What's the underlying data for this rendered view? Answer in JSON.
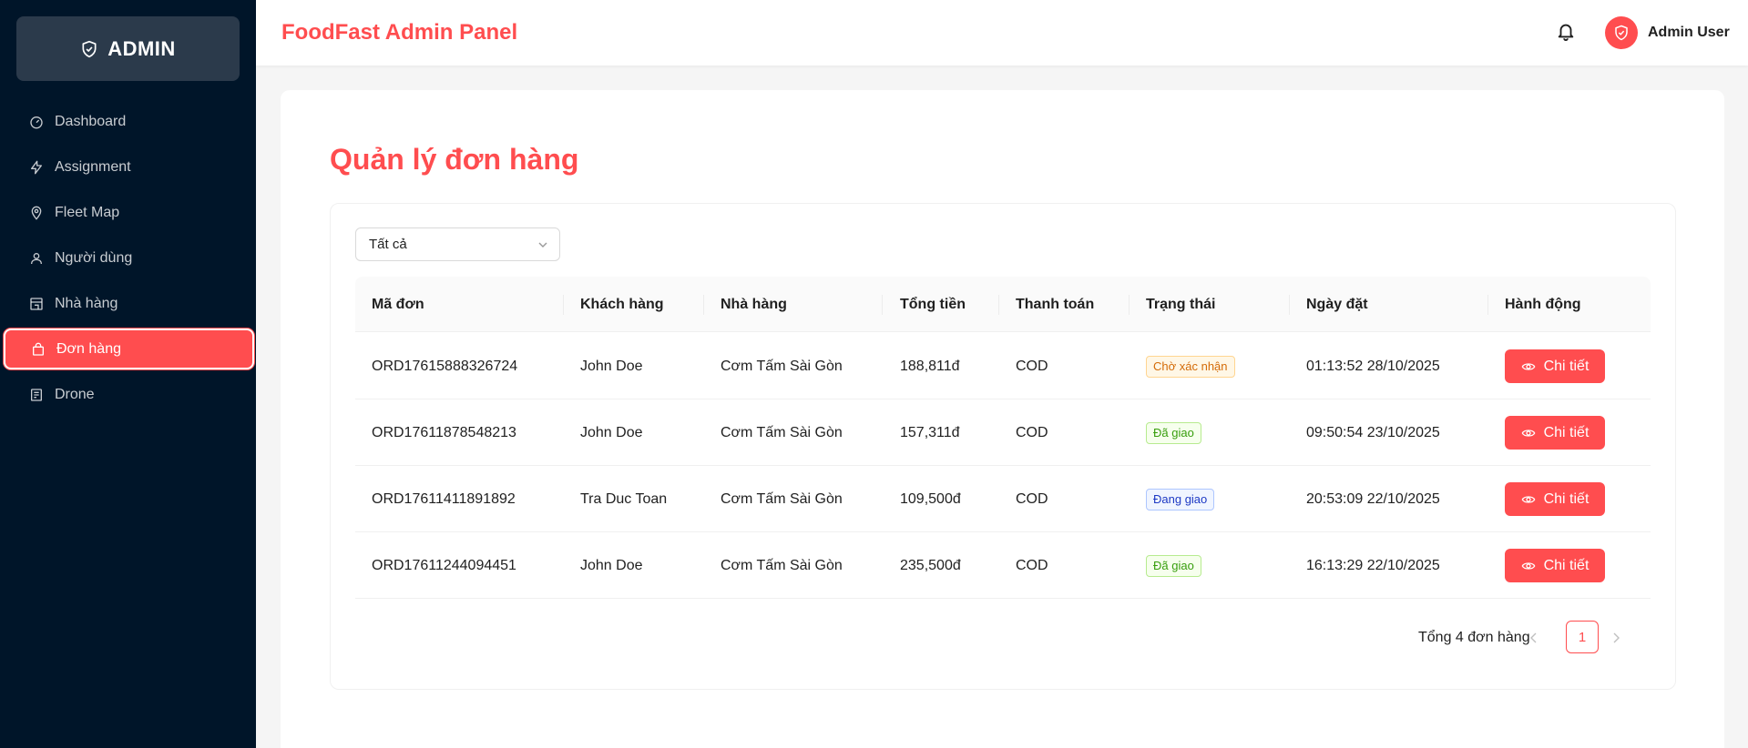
{
  "sidebar": {
    "brand": "ADMIN",
    "items": [
      {
        "label": "Dashboard",
        "icon": "dashboard-icon"
      },
      {
        "label": "Assignment",
        "icon": "lightning-icon"
      },
      {
        "label": "Fleet Map",
        "icon": "map-pin-icon"
      },
      {
        "label": "Người dùng",
        "icon": "user-icon"
      },
      {
        "label": "Nhà hàng",
        "icon": "shop-icon"
      },
      {
        "label": "Đơn hàng",
        "icon": "shopping-bag-icon",
        "active": true
      },
      {
        "label": "Drone",
        "icon": "drone-icon"
      }
    ]
  },
  "header": {
    "title": "FoodFast Admin Panel",
    "user_name": "Admin User"
  },
  "main": {
    "page_title": "Quản lý đơn hàng",
    "filter": {
      "selected": "Tất cả"
    },
    "columns": [
      "Mã đơn",
      "Khách hàng",
      "Nhà hàng",
      "Tổng tiền",
      "Thanh toán",
      "Trạng thái",
      "Ngày đặt",
      "Hành động"
    ],
    "rows": [
      {
        "id": "ORD17615888326724",
        "customer": "John Doe",
        "restaurant": "Cơm Tấm Sài Gòn",
        "total": "188,811đ",
        "payment": "COD",
        "status": "Chờ xác nhận",
        "status_color": "orange",
        "date": "01:13:52 28/10/2025",
        "action": "Chi tiết"
      },
      {
        "id": "ORD17611878548213",
        "customer": "John Doe",
        "restaurant": "Cơm Tấm Sài Gòn",
        "total": "157,311đ",
        "payment": "COD",
        "status": "Đã giao",
        "status_color": "green",
        "date": "09:50:54 23/10/2025",
        "action": "Chi tiết"
      },
      {
        "id": "ORD17611411891892",
        "customer": "Tra Duc Toan",
        "restaurant": "Cơm Tấm Sài Gòn",
        "total": "109,500đ",
        "payment": "COD",
        "status": "Đang giao",
        "status_color": "blue",
        "date": "20:53:09 22/10/2025",
        "action": "Chi tiết"
      },
      {
        "id": "ORD17611244094451",
        "customer": "John Doe",
        "restaurant": "Cơm Tấm Sài Gòn",
        "total": "235,500đ",
        "payment": "COD",
        "status": "Đã giao",
        "status_color": "green",
        "date": "16:13:29 22/10/2025",
        "action": "Chi tiết"
      }
    ],
    "pagination": {
      "total_text": "Tổng 4 đơn hàng",
      "current_page": "1"
    }
  },
  "colors": {
    "accent": "#ff4d4f",
    "sidebar_bg": "#001529"
  }
}
